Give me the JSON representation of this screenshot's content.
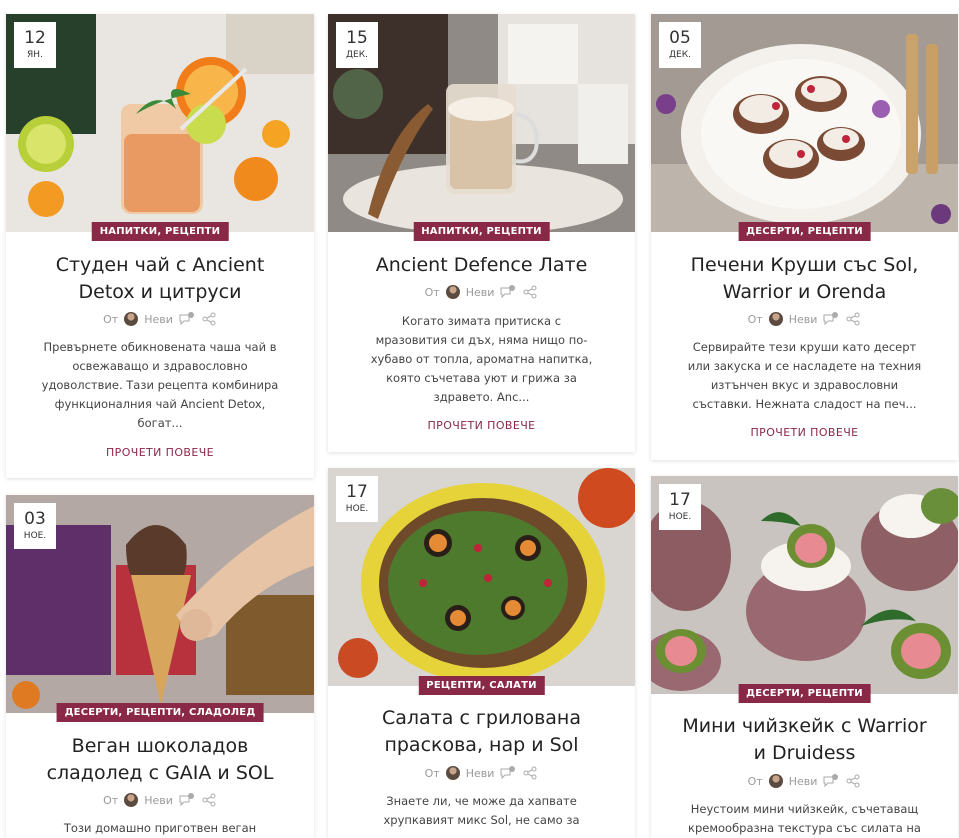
{
  "posts": [
    {
      "day": "12",
      "month": "ян.",
      "categories": "НАПИТКИ, РЕЦЕПТИ",
      "title_line1": "Студен чай с Ancient",
      "title_line2": "Detox и цитруси",
      "by": "От",
      "author": "Неви",
      "comments": "0",
      "excerpt_lines": [
        "Превърнете обикновената чаша чай в",
        "освежаващо и здравословно",
        "удоволствие. Тази рецепта комбинира",
        "функционалния чай Ancient Detox,",
        "богат..."
      ],
      "read_more": "ПРОЧЕТИ ПОВЕЧЕ"
    },
    {
      "day": "15",
      "month": "дек.",
      "categories": "НАПИТКИ, РЕЦЕПТИ",
      "title_line1": "Ancient Defence Лате",
      "title_line2": "",
      "by": "От",
      "author": "Неви",
      "comments": "0",
      "excerpt_lines": [
        "Когато зимата притиска с",
        "мразовития си дъх, няма нищо по-",
        "хубаво от топла, ароматна напитка,",
        "която съчетава уют и грижа за",
        "здравето. Anc..."
      ],
      "read_more": "ПРОЧЕТИ ПОВЕЧЕ"
    },
    {
      "day": "05",
      "month": "дек.",
      "categories": "ДЕСЕРТИ, РЕЦЕПТИ",
      "title_line1": "Печени Круши със Sol,",
      "title_line2": "Warrior и Orenda",
      "by": "От",
      "author": "Неви",
      "comments": "0",
      "excerpt_lines": [
        "Сервирайте тези круши като десерт",
        "или закуска и се насладете на техния",
        "изтънчен вкус и здравословни",
        "съставки. Нежната сладост на печ..."
      ],
      "read_more": "ПРОЧЕТИ ПОВЕЧЕ"
    },
    {
      "day": "03",
      "month": "ное.",
      "categories": "ДЕСЕРТИ, РЕЦЕПТИ, СЛАДОЛЕД",
      "title_line1": "Веган шоколадов",
      "title_line2": "сладолед с GAIA и SOL",
      "by": "От",
      "author": "Неви",
      "comments": "0",
      "excerpt_lines": [
        "Този домашно приготвен веган"
      ],
      "read_more": ""
    },
    {
      "day": "17",
      "month": "ное.",
      "categories": "РЕЦЕПТИ, САЛАТИ",
      "title_line1": "Салата с грилована",
      "title_line2": "праскова, нар и Sol",
      "by": "От",
      "author": "Неви",
      "comments": "0",
      "excerpt_lines": [
        "Знаете ли, че може да хапвате",
        "хрупкавият микс Sol, не само за"
      ],
      "read_more": ""
    },
    {
      "day": "17",
      "month": "ное.",
      "categories": "ДЕСЕРТИ, РЕЦЕПТИ",
      "title_line1": "Мини чийзкейк с Warrior",
      "title_line2": "и Druidess",
      "by": "От",
      "author": "Неви",
      "comments": "0",
      "excerpt_lines": [
        "Неустоим мини чийзкейк, съчетаващ",
        "кремообразна текстура със силата на"
      ],
      "read_more": ""
    }
  ],
  "colors": {
    "accent": "#8a2848",
    "meta": "#9a9a9a",
    "text": "#222222"
  },
  "icons": [
    "avatar",
    "comment-icon",
    "share-icon"
  ]
}
